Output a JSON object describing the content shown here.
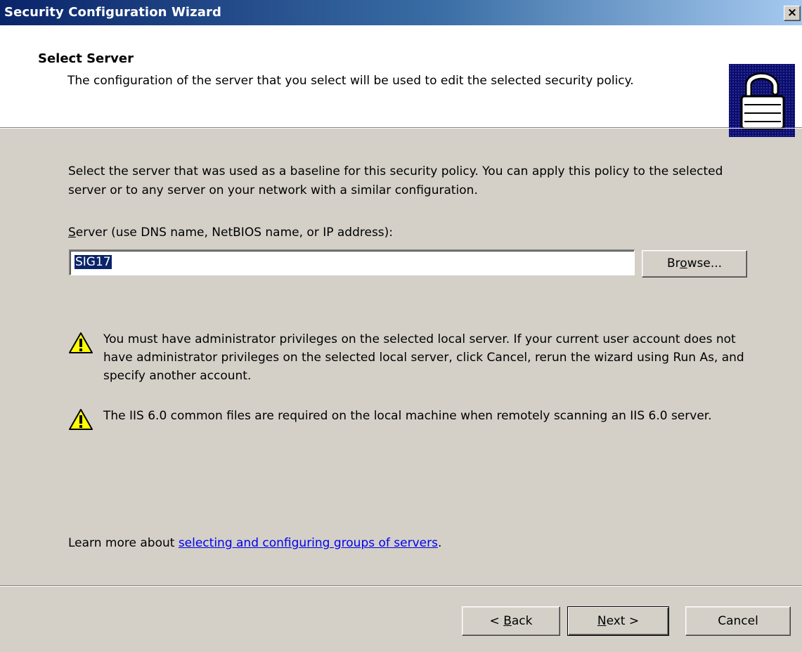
{
  "window": {
    "title": "Security Configuration Wizard",
    "close_label": "×"
  },
  "header": {
    "title": "Select Server",
    "subtitle": "The configuration of the server that you select will be used to edit the selected security policy.",
    "icon": "padlock-icon"
  },
  "main": {
    "description": "Select the server that was used as a baseline for this security policy. You can apply this policy to the selected server or to any server on your network with a similar configuration.",
    "server_label_first": "S",
    "server_label_rest": "erver (use DNS name, NetBIOS name, or IP address):",
    "server_value": "SIG17",
    "browse": {
      "pre": "Br",
      "key": "o",
      "post": "wse..."
    },
    "warnings": [
      {
        "icon": "warning-icon",
        "text": "You must have administrator privileges on the selected local server. If your current user account does not have administrator privileges on the selected local server, click Cancel, rerun the wizard using Run As, and specify another account."
      },
      {
        "icon": "warning-icon",
        "text": "The IIS 6.0 common files are required on the local machine when remotely scanning an IIS 6.0 server."
      }
    ],
    "learn_more_prefix": "Learn more about ",
    "learn_more_link": "selecting and configuring groups of servers",
    "learn_more_suffix": "."
  },
  "footer": {
    "back": {
      "pre": "< ",
      "key": "B",
      "post": "ack"
    },
    "next": {
      "pre": "",
      "key": "N",
      "post": "ext >"
    },
    "cancel": "Cancel"
  },
  "colors": {
    "titlebar_start": "#0a246a",
    "titlebar_end": "#a6caf0",
    "dialog_face": "#d4d0c8",
    "selection": "#0a246a",
    "link": "#0000ee"
  }
}
